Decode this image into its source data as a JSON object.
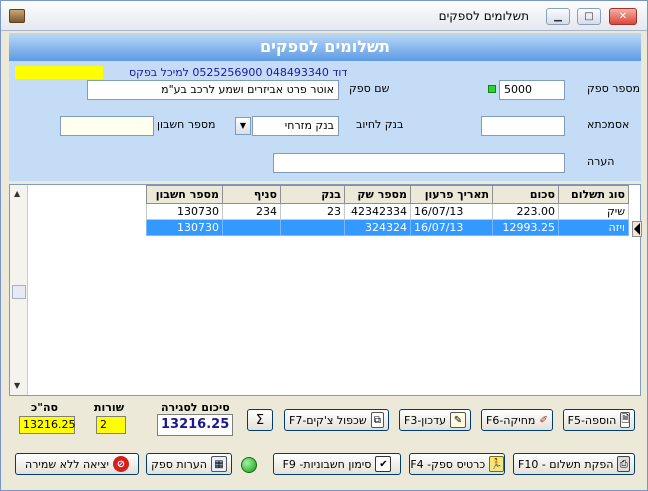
{
  "window": {
    "title": "תשלומים לספקים",
    "controls": {
      "minimize": "▁",
      "maximize": "□",
      "close": "✕"
    }
  },
  "header": {
    "title": "תשלומים לספקים"
  },
  "form": {
    "supplier_info": "דוד 048493340 0525256900 למיכל בפקס",
    "supplier_number_label": "מספר ספק",
    "supplier_number": "5000",
    "supplier_name_label": "שם ספק",
    "supplier_name": "אוטר פרט אביזרים ושמע לרכב בע\"מ",
    "asmachta_label": "אסמכתא",
    "asmachta": "",
    "bank_debit_label": "בנק לחיוב",
    "bank_debit": "בנק מזרחי",
    "account_number_label": "מספר חשבון",
    "account_number": "",
    "note_label": "הערה",
    "note": ""
  },
  "grid": {
    "columns": [
      "סוג תשלום",
      "סכום",
      "תאריך פרעון",
      "מספר שק",
      "בנק",
      "סניף",
      "מספר חשבון"
    ],
    "rows": [
      [
        "שיק",
        "223.00",
        "16/07/13",
        "42342334",
        "23",
        "234",
        "130730"
      ],
      [
        "ויזה",
        "12993.25",
        "16/07/13",
        "324324",
        "",
        "",
        "130730"
      ]
    ]
  },
  "summary": {
    "total_label": "סה\"כ",
    "total": "13216.25",
    "rows_label": "שורות",
    "rows": "2",
    "closing_label": "סיכום לסגירה",
    "closing": "13216.25"
  },
  "buttons": {
    "add": "הוספה-F5",
    "delete": "מחיקה-F6",
    "update": "עדכון-F3",
    "duplicate_checks": "שכפול צ'קים-F7",
    "sum": "Σ",
    "print_payment": "הפקת תשלום - F10",
    "supplier_card": "כרטיס ספק- F4",
    "mark_invoices": "סימון חשבוניות- F9",
    "supplier_notes": "הערות ספק",
    "exit_no_save": "יציאה ללא שמירה"
  }
}
